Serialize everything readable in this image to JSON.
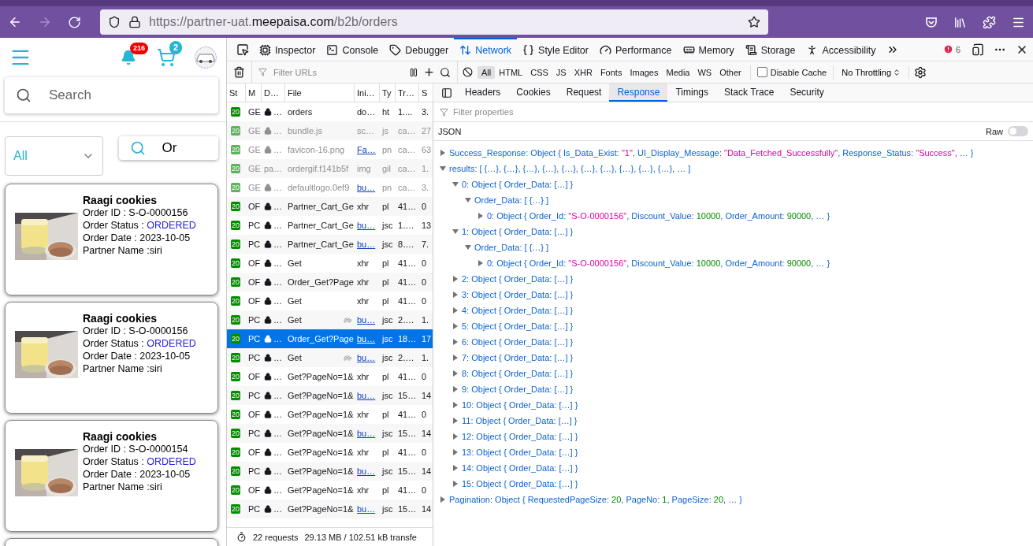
{
  "browser": {
    "forward_disabled": true,
    "url_parts": [
      {
        "kind": "dim",
        "text": "https://partner-uat."
      },
      {
        "kind": "domain",
        "text": "meepaisa.com"
      },
      {
        "kind": "dim",
        "text": "/b2b/orders"
      }
    ]
  },
  "app": {
    "notifications": "216",
    "cart_count": "2",
    "search": {
      "placeholder": "Search"
    },
    "filter": {
      "value": "All"
    },
    "search_button": "Or",
    "orders": [
      {
        "title": "Raagi cookies",
        "order_id": "Order ID : S-O-0000156",
        "status_label": "Order Status : ",
        "status": "ORDERED",
        "date": "Order Date : 2023-10-05",
        "partner": "Partner Name :siri"
      },
      {
        "title": "Raagi cookies",
        "order_id": "Order ID : S-O-0000156",
        "status_label": "Order Status : ",
        "status": "ORDERED",
        "date": "Order Date : 2023-10-05",
        "partner": "Partner Name :siri"
      },
      {
        "title": "Raagi cookies",
        "order_id": "Order ID : S-O-0000154",
        "status_label": "Order Status : ",
        "status": "ORDERED",
        "date": "Order Date : 2023-10-05",
        "partner": "Partner Name :siri"
      }
    ]
  },
  "devtools": {
    "tabs": [
      {
        "label": "Inspector",
        "selected": false
      },
      {
        "label": "Console",
        "selected": false
      },
      {
        "label": "Debugger",
        "selected": false
      },
      {
        "label": "Network",
        "selected": true
      },
      {
        "label": "Style Editor",
        "selected": false
      },
      {
        "label": "Performance",
        "selected": false
      },
      {
        "label": "Memory",
        "selected": false
      },
      {
        "label": "Storage",
        "selected": false
      },
      {
        "label": "Accessibility",
        "selected": false
      }
    ],
    "error_count": "6",
    "filter": {
      "placeholder": "Filter URLs"
    },
    "type_filters": [
      {
        "label": "All",
        "selected": true
      },
      {
        "label": "HTML",
        "selected": false
      },
      {
        "label": "CSS",
        "selected": false
      },
      {
        "label": "JS",
        "selected": false
      },
      {
        "label": "XHR",
        "selected": false
      },
      {
        "label": "Fonts",
        "selected": false
      },
      {
        "label": "Images",
        "selected": false
      },
      {
        "label": "Media",
        "selected": false
      },
      {
        "label": "WS",
        "selected": false
      },
      {
        "label": "Other",
        "selected": false
      }
    ],
    "disable_cache": {
      "label": "Disable Cache",
      "checked": false
    },
    "throttling": "No Throttling",
    "columns": [
      "St",
      "M",
      "D…",
      "File",
      "Ini…",
      "Ty",
      "Tr…",
      "S"
    ],
    "requests": [
      {
        "status": "20",
        "method": "GE",
        "domain": "…",
        "secure": true,
        "file": "orders",
        "initiator": "do…",
        "initiator_link": false,
        "type": "ht",
        "transferred": "1....",
        "size": "3.",
        "cached": false,
        "throttled": false,
        "selected": false
      },
      {
        "status": "20",
        "method": "GE",
        "domain": "…",
        "secure": true,
        "file": "bundle.js",
        "initiator": "sc…",
        "initiator_link": false,
        "type": "js",
        "transferred": "ca…",
        "size": "27",
        "cached": true,
        "throttled": false,
        "selected": false
      },
      {
        "status": "20",
        "method": "GE",
        "domain": "…",
        "secure": true,
        "file": "favicon-16.png",
        "initiator": "Fa…",
        "initiator_link": true,
        "type": "pn",
        "transferred": "ca…",
        "size": "63",
        "cached": true,
        "throttled": false,
        "selected": false
      },
      {
        "status": "20",
        "method": "GE",
        "domain": "pa…",
        "secure": false,
        "file": "ordergif.f141b5f",
        "initiator": "img",
        "initiator_link": false,
        "type": "gil",
        "transferred": "ca…",
        "size": "1.",
        "cached": true,
        "throttled": false,
        "selected": false
      },
      {
        "status": "20",
        "method": "GE",
        "domain": "…",
        "secure": true,
        "file": "defaultlogo.0ef9",
        "initiator": "bu…",
        "initiator_link": true,
        "type": "pn",
        "transferred": "ca…",
        "size": "3.",
        "cached": true,
        "throttled": false,
        "selected": false
      },
      {
        "status": "20",
        "method": "OF",
        "domain": "…",
        "secure": true,
        "file": "Partner_Cart_Ge",
        "initiator": "xhr",
        "initiator_link": false,
        "type": "pl",
        "transferred": "41…",
        "size": "0",
        "cached": false,
        "throttled": false,
        "selected": false
      },
      {
        "status": "20",
        "method": "PC",
        "domain": "…",
        "secure": true,
        "file": "Partner_Cart_Ge",
        "initiator": "bu…",
        "initiator_link": true,
        "type": "jsc",
        "transferred": "1….",
        "size": "13",
        "cached": false,
        "throttled": false,
        "selected": false
      },
      {
        "status": "20",
        "method": "PC",
        "domain": "…",
        "secure": true,
        "file": "Partner_Cart_Ge",
        "initiator": "bu…",
        "initiator_link": true,
        "type": "jsc",
        "transferred": "8….",
        "size": "7.",
        "cached": false,
        "throttled": false,
        "selected": false
      },
      {
        "status": "20",
        "method": "OF",
        "domain": "…",
        "secure": true,
        "file": "Get",
        "initiator": "xhr",
        "initiator_link": false,
        "type": "pl",
        "transferred": "41…",
        "size": "0",
        "cached": false,
        "throttled": false,
        "selected": false
      },
      {
        "status": "20",
        "method": "OF",
        "domain": "…",
        "secure": true,
        "file": "Order_Get?Page",
        "initiator": "xhr",
        "initiator_link": false,
        "type": "pl",
        "transferred": "41…",
        "size": "0",
        "cached": false,
        "throttled": false,
        "selected": false
      },
      {
        "status": "20",
        "method": "OF",
        "domain": "…",
        "secure": true,
        "file": "Get",
        "initiator": "xhr",
        "initiator_link": false,
        "type": "pl",
        "transferred": "41…",
        "size": "0",
        "cached": false,
        "throttled": false,
        "selected": false
      },
      {
        "status": "20",
        "method": "PC",
        "domain": "…",
        "secure": true,
        "file": "Get",
        "initiator": "bu…",
        "initiator_link": true,
        "type": "jsc",
        "transferred": "2….",
        "size": "1.",
        "cached": false,
        "throttled": true,
        "selected": false
      },
      {
        "status": "20",
        "method": "PC",
        "domain": "…",
        "secure": true,
        "file": "Order_Get?Page",
        "initiator": "bu…",
        "initiator_link": true,
        "type": "jsc",
        "transferred": "18…",
        "size": "17",
        "cached": false,
        "throttled": false,
        "selected": true
      },
      {
        "status": "20",
        "method": "PC",
        "domain": "…",
        "secure": true,
        "file": "Get",
        "initiator": "bu…",
        "initiator_link": true,
        "type": "jsc",
        "transferred": "2….",
        "size": "1.",
        "cached": false,
        "throttled": true,
        "selected": false
      },
      {
        "status": "20",
        "method": "OF",
        "domain": "…",
        "secure": true,
        "file": "Get?PageNo=1&",
        "initiator": "xhr",
        "initiator_link": false,
        "type": "pl",
        "transferred": "41…",
        "size": "0",
        "cached": false,
        "throttled": false,
        "selected": false
      },
      {
        "status": "20",
        "method": "PC",
        "domain": "…",
        "secure": true,
        "file": "Get?PageNo=1&",
        "initiator": "bu…",
        "initiator_link": true,
        "type": "jsc",
        "transferred": "15…",
        "size": "14",
        "cached": false,
        "throttled": false,
        "selected": false
      },
      {
        "status": "20",
        "method": "OF",
        "domain": "…",
        "secure": true,
        "file": "Get?PageNo=1&",
        "initiator": "xhr",
        "initiator_link": false,
        "type": "pl",
        "transferred": "41…",
        "size": "0",
        "cached": false,
        "throttled": false,
        "selected": false
      },
      {
        "status": "20",
        "method": "PC",
        "domain": "…",
        "secure": true,
        "file": "Get?PageNo=1&",
        "initiator": "bu…",
        "initiator_link": true,
        "type": "jsc",
        "transferred": "15…",
        "size": "14",
        "cached": false,
        "throttled": false,
        "selected": false
      },
      {
        "status": "20",
        "method": "OF",
        "domain": "…",
        "secure": true,
        "file": "Get?PageNo=1&",
        "initiator": "xhr",
        "initiator_link": false,
        "type": "pl",
        "transferred": "41…",
        "size": "0",
        "cached": false,
        "throttled": false,
        "selected": false
      },
      {
        "status": "20",
        "method": "PC",
        "domain": "…",
        "secure": true,
        "file": "Get?PageNo=1&",
        "initiator": "bu…",
        "initiator_link": true,
        "type": "jsc",
        "transferred": "15…",
        "size": "14",
        "cached": false,
        "throttled": false,
        "selected": false
      },
      {
        "status": "20",
        "method": "OF",
        "domain": "…",
        "secure": true,
        "file": "Get?PageNo=1&",
        "initiator": "xhr",
        "initiator_link": false,
        "type": "pl",
        "transferred": "41…",
        "size": "0",
        "cached": false,
        "throttled": false,
        "selected": false
      },
      {
        "status": "20",
        "method": "PC",
        "domain": "…",
        "secure": true,
        "file": "Get?PageNo=1&",
        "initiator": "bu…",
        "initiator_link": true,
        "type": "jsc",
        "transferred": "15…",
        "size": "14",
        "cached": false,
        "throttled": false,
        "selected": false
      }
    ],
    "summary": [
      "22 requests",
      "29.13 MB / 102.51 kB transfe"
    ],
    "detail_tabs": [
      {
        "label": "Headers",
        "selected": false
      },
      {
        "label": "Cookies",
        "selected": false
      },
      {
        "label": "Request",
        "selected": false
      },
      {
        "label": "Response",
        "selected": true
      },
      {
        "label": "Timings",
        "selected": false
      },
      {
        "label": "Stack Trace",
        "selected": false
      },
      {
        "label": "Security",
        "selected": false
      }
    ],
    "properties_filter": {
      "placeholder": "Filter properties"
    },
    "format": "JSON",
    "raw": {
      "label": "Raw",
      "on": false
    },
    "tree": [
      {
        "expanded": false,
        "parts": [
          {
            "kind": "key",
            "text": "Success_Response: Object { Is_Data_Exist: "
          },
          {
            "kind": "string",
            "text": "\"1\""
          },
          {
            "kind": "key",
            "text": ", UI_Display_Message: "
          },
          {
            "kind": "string",
            "text": "\"Data_Fetched_Successfully\""
          },
          {
            "kind": "key",
            "text": ", Response_Status: "
          },
          {
            "kind": "string",
            "text": "\"Success\""
          },
          {
            "kind": "key",
            "text": ", … }"
          }
        ]
      },
      {
        "expanded": true,
        "parts": [
          {
            "kind": "key",
            "text": "results: [ {…}, {…}, {…}, {…}, {…}, {…}, {…}, {…}, {…}, {…}, … ]"
          }
        ],
        "children": [
          {
            "expanded": true,
            "parts": [
              {
                "kind": "key",
                "text": "0: Object { Order_Data: […] }"
              }
            ],
            "children": [
              {
                "expanded": true,
                "parts": [
                  {
                    "kind": "key",
                    "text": "Order_Data: [ {…} ]"
                  }
                ],
                "children": [
                  {
                    "expanded": false,
                    "parts": [
                      {
                        "kind": "key",
                        "text": "0: Object { Order_Id: "
                      },
                      {
                        "kind": "string",
                        "text": "\"S-O-0000156\""
                      },
                      {
                        "kind": "key",
                        "text": ", Discount_Value: "
                      },
                      {
                        "kind": "number",
                        "text": "10000"
                      },
                      {
                        "kind": "key",
                        "text": ", Order_Amount: "
                      },
                      {
                        "kind": "number",
                        "text": "90000"
                      },
                      {
                        "kind": "key",
                        "text": ", … }"
                      }
                    ]
                  }
                ]
              }
            ]
          },
          {
            "expanded": true,
            "parts": [
              {
                "kind": "key",
                "text": "1: Object { Order_Data: […] }"
              }
            ],
            "children": [
              {
                "expanded": true,
                "parts": [
                  {
                    "kind": "key",
                    "text": "Order_Data: [ {…} ]"
                  }
                ],
                "children": [
                  {
                    "expanded": false,
                    "parts": [
                      {
                        "kind": "key",
                        "text": "0: Object { Order_Id: "
                      },
                      {
                        "kind": "string",
                        "text": "\"S-O-0000156\""
                      },
                      {
                        "kind": "key",
                        "text": ", Discount_Value: "
                      },
                      {
                        "kind": "number",
                        "text": "10000"
                      },
                      {
                        "kind": "key",
                        "text": ", Order_Amount: "
                      },
                      {
                        "kind": "number",
                        "text": "90000"
                      },
                      {
                        "kind": "key",
                        "text": ", … }"
                      }
                    ]
                  }
                ]
              }
            ]
          },
          {
            "expanded": false,
            "parts": [
              {
                "kind": "key",
                "text": "2: Object { Order_Data: […] }"
              }
            ]
          },
          {
            "expanded": false,
            "parts": [
              {
                "kind": "key",
                "text": "3: Object { Order_Data: […] }"
              }
            ]
          },
          {
            "expanded": false,
            "parts": [
              {
                "kind": "key",
                "text": "4: Object { Order_Data: […] }"
              }
            ]
          },
          {
            "expanded": false,
            "parts": [
              {
                "kind": "key",
                "text": "5: Object { Order_Data: […] }"
              }
            ]
          },
          {
            "expanded": false,
            "parts": [
              {
                "kind": "key",
                "text": "6: Object { Order_Data: […] }"
              }
            ]
          },
          {
            "expanded": false,
            "parts": [
              {
                "kind": "key",
                "text": "7: Object { Order_Data: […] }"
              }
            ]
          },
          {
            "expanded": false,
            "parts": [
              {
                "kind": "key",
                "text": "8: Object { Order_Data: […] }"
              }
            ]
          },
          {
            "expanded": false,
            "parts": [
              {
                "kind": "key",
                "text": "9: Object { Order_Data: […] }"
              }
            ]
          },
          {
            "expanded": false,
            "parts": [
              {
                "kind": "key",
                "text": "10: Object { Order_Data: […] }"
              }
            ]
          },
          {
            "expanded": false,
            "parts": [
              {
                "kind": "key",
                "text": "11: Object { Order_Data: […] }"
              }
            ]
          },
          {
            "expanded": false,
            "parts": [
              {
                "kind": "key",
                "text": "12: Object { Order_Data: […] }"
              }
            ]
          },
          {
            "expanded": false,
            "parts": [
              {
                "kind": "key",
                "text": "13: Object { Order_Data: […] }"
              }
            ]
          },
          {
            "expanded": false,
            "parts": [
              {
                "kind": "key",
                "text": "14: Object { Order_Data: […] }"
              }
            ]
          },
          {
            "expanded": false,
            "parts": [
              {
                "kind": "key",
                "text": "15: Object { Order_Data: […] }"
              }
            ]
          }
        ]
      },
      {
        "expanded": false,
        "parts": [
          {
            "kind": "key",
            "text": "Pagination: Object { RequestedPageSize: "
          },
          {
            "kind": "number",
            "text": "20"
          },
          {
            "kind": "key",
            "text": ", PageNo: "
          },
          {
            "kind": "number",
            "text": "1"
          },
          {
            "kind": "key",
            "text": ", PageSize: "
          },
          {
            "kind": "number",
            "text": "20"
          },
          {
            "kind": "key",
            "text": ", … }"
          }
        ]
      }
    ]
  }
}
